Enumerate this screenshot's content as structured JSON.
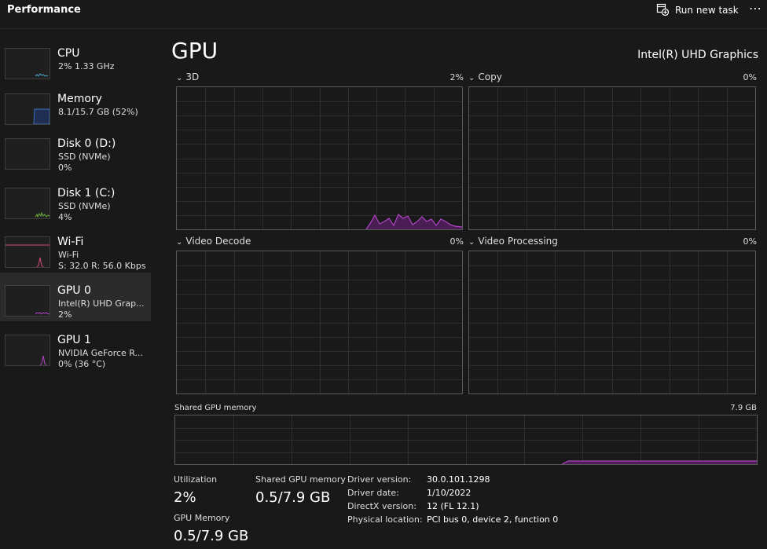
{
  "header": {
    "title": "Performance",
    "run_task_label": "Run new task",
    "more_label": "⋯"
  },
  "sidebar": {
    "items": [
      {
        "name": "CPU",
        "sub1": "2% 1.33 GHz",
        "sub2": "",
        "color": "#4fa3c7",
        "selected": false
      },
      {
        "name": "Memory",
        "sub1": "8.1/15.7 GB (52%)",
        "sub2": "",
        "color": "#3f6fbf",
        "selected": false
      },
      {
        "name": "Disk 0 (D:)",
        "sub1": "SSD (NVMe)",
        "sub2": "0%",
        "color": "#6fb13f",
        "selected": false
      },
      {
        "name": "Disk 1 (C:)",
        "sub1": "SSD (NVMe)",
        "sub2": "4%",
        "color": "#6fb13f",
        "selected": false
      },
      {
        "name": "Wi-Fi",
        "sub1": "Wi-Fi",
        "sub2": "S: 32.0  R: 56.0 Kbps",
        "color": "#d4487f",
        "selected": false
      },
      {
        "name": "GPU 0",
        "sub1": "Intel(R) UHD Grap...",
        "sub2": "2%",
        "color": "#b044c4",
        "selected": true
      },
      {
        "name": "GPU 1",
        "sub1": "NVIDIA GeForce R...",
        "sub2": "0%  (36 °C)",
        "color": "#b044c4",
        "selected": false
      }
    ]
  },
  "main": {
    "title": "GPU",
    "adapter_name": "Intel(R) UHD Graphics",
    "graphs": [
      {
        "label": "3D",
        "percent": "2%"
      },
      {
        "label": "Copy",
        "percent": "0%"
      },
      {
        "label": "Video Decode",
        "percent": "0%"
      },
      {
        "label": "Video Processing",
        "percent": "0%"
      }
    ],
    "shared_memory_graph": {
      "label": "Shared GPU memory",
      "max": "7.9 GB"
    },
    "stats": {
      "utilization_label": "Utilization",
      "utilization_value": "2%",
      "shared_mem_label": "Shared GPU memory",
      "shared_mem_value": "0.5/7.9 GB",
      "gpu_mem_label": "GPU Memory",
      "gpu_mem_value": "0.5/7.9 GB"
    },
    "info": [
      {
        "key": "Driver version:",
        "value": "30.0.101.1298"
      },
      {
        "key": "Driver date:",
        "value": "1/10/2022"
      },
      {
        "key": "DirectX version:",
        "value": "12 (FL 12.1)"
      },
      {
        "key": "Physical location:",
        "value": "PCI bus 0, device 2, function 0"
      }
    ]
  },
  "colors": {
    "gpu_line": "#b044c4",
    "gpu_fill": "#4a1e55",
    "grid": "#2e2e2e"
  }
}
